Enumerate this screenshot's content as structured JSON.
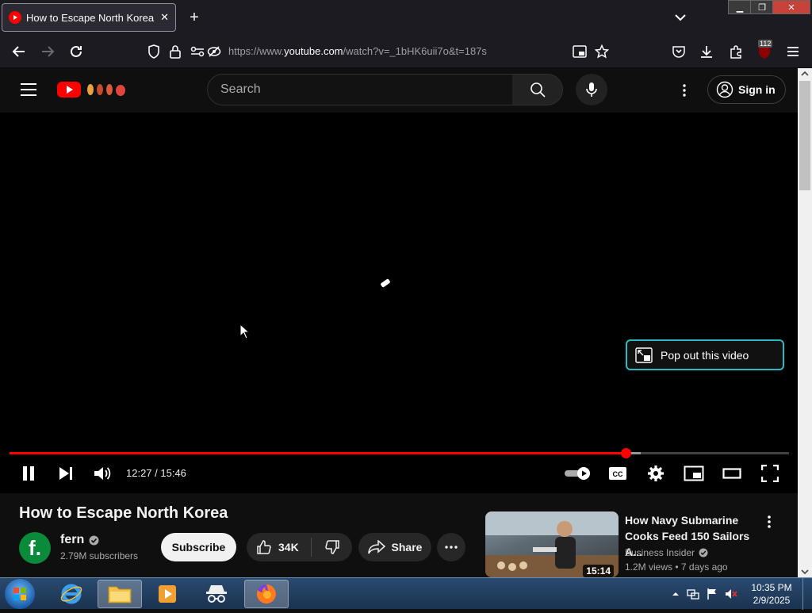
{
  "browser": {
    "tab_title": "How to Escape North Korea - YouTube",
    "url_prefix": "https://www.",
    "url_host": "youtube.com",
    "url_path": "/watch?v=_1bHK6uii7o&t=187s",
    "extension_badge": "112",
    "accent_color": "#fbfbfe"
  },
  "masthead": {
    "search_placeholder": "Search",
    "sign_in_label": "Sign in"
  },
  "player": {
    "current_time": "12:27",
    "duration": "15:46",
    "time_display": "12:27 / 15:46",
    "progress_fraction": 0.79,
    "buffered_fraction": 0.81,
    "popout_label": "Pop out this video",
    "progress_color": "#ff0000"
  },
  "video": {
    "title": "How to Escape North Korea",
    "channel_initial": "f.",
    "channel_name": "fern",
    "subscribers": "2.79M subscribers",
    "subscribe_label": "Subscribe",
    "likes": "34K",
    "share_label": "Share"
  },
  "recommended": [
    {
      "title": "How Navy Submarine Cooks Feed 150 Sailors A...",
      "channel": "Business Insider",
      "views": "1.2M views",
      "age": "7 days ago",
      "meta": "1.2M views • 7 days ago",
      "duration": "15:14"
    }
  ],
  "taskbar": {
    "time": "10:35 PM",
    "date": "2/9/2025"
  }
}
